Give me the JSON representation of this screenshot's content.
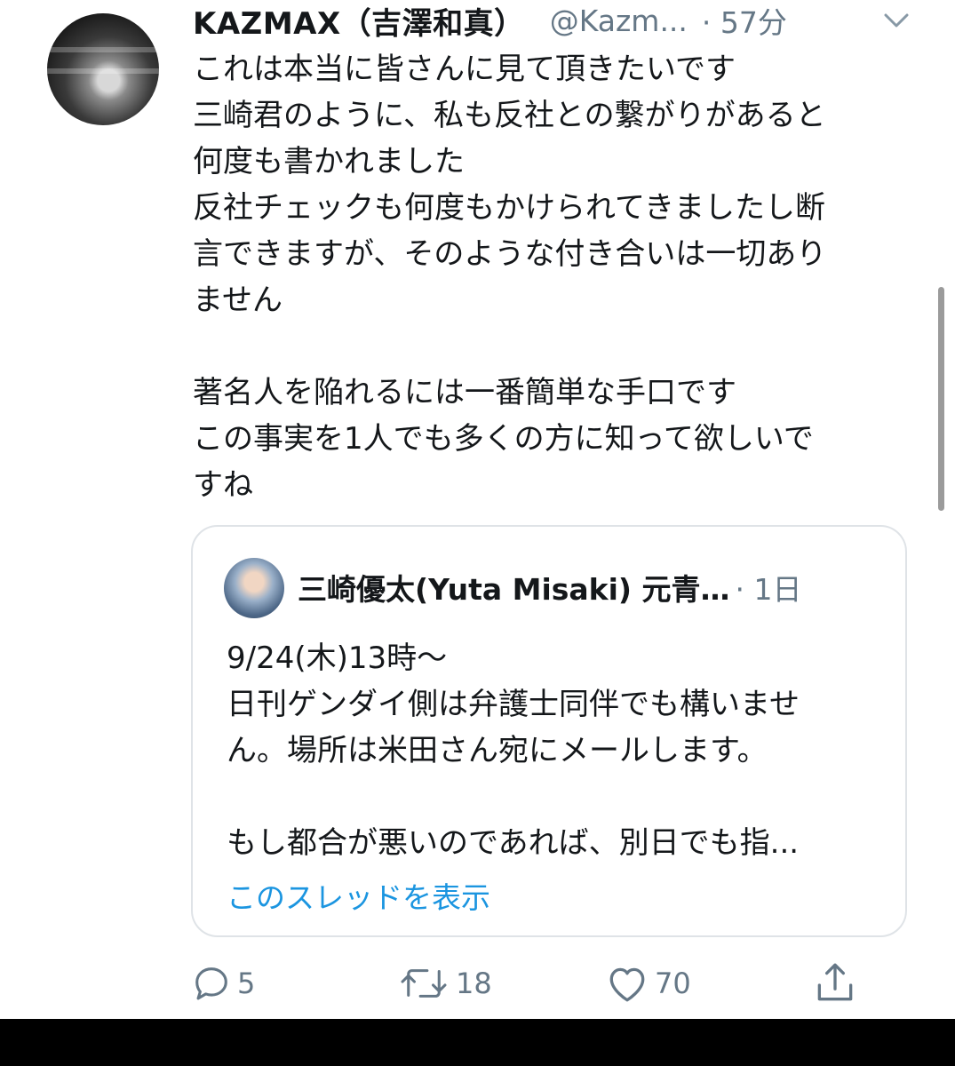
{
  "tweet": {
    "author_name": "KAZMAX（吉澤和真）",
    "handle": "@Kazm...",
    "time": "· 57分",
    "lines": [
      "これは本当に皆さんに見て頂きたいです",
      "三崎君のように、私も反社との繋がりがあると",
      "何度も書かれました",
      "反社チェックも何度もかけられてきましたし断",
      "言できますが、そのような付き合いは一切あり",
      "ません",
      "",
      "著名人を陥れるには一番簡単な手口です",
      "この事実を1人でも多くの方に知って欲しいで",
      "すね"
    ]
  },
  "quote": {
    "author_name": "三崎優太(Yuta Misaki) 元青…",
    "time": "· 1日",
    "lines": [
      "9/24(木)13時〜",
      "日刊ゲンダイ側は弁護士同伴でも構いませ",
      "ん。場所は米田さん宛にメールします。",
      "",
      "もし都合が悪いのであれば、別日でも指..."
    ],
    "show_thread": "このスレッドを表示"
  },
  "actions": {
    "reply_count": "5",
    "retweet_count": "18",
    "like_count": "70"
  },
  "icons": {
    "reply": "reply-icon",
    "retweet": "retweet-icon",
    "like": "like-icon",
    "share": "share-icon",
    "more": "chevron-down-icon"
  },
  "colors": {
    "text": "#14171a",
    "secondary": "#657786",
    "link": "#1b95e0",
    "border": "#dfe3e7"
  }
}
